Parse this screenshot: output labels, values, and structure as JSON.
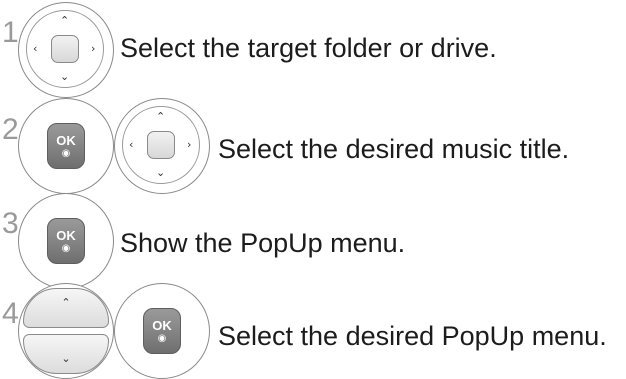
{
  "steps": [
    {
      "number": "1",
      "text": "Select the target folder or drive.",
      "icons": [
        "navigation-dpad-icon"
      ]
    },
    {
      "number": "2",
      "text": "Select the desired music title.",
      "icons": [
        "ok-button-icon",
        "navigation-dpad-icon"
      ]
    },
    {
      "number": "3",
      "text": "Show the PopUp menu.",
      "icons": [
        "ok-button-icon"
      ]
    },
    {
      "number": "4",
      "text": "Select the desired PopUp menu.",
      "icons": [
        "up-down-rocker-icon",
        "ok-button-icon"
      ]
    }
  ],
  "ok_label": "OK",
  "colors": {
    "number": "#9a9a9a",
    "text": "#1c1c1c",
    "ok_button": "#7a7a7a",
    "ring": "#8a8a8a"
  }
}
